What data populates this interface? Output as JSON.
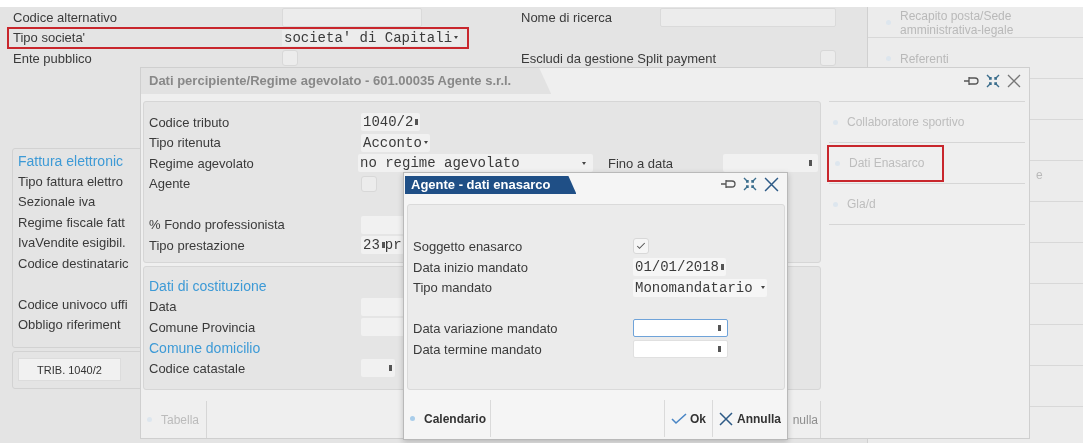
{
  "background_form": {
    "rows": [
      {
        "label": "Codice alternativo",
        "kind": "field",
        "highlighted": false
      },
      {
        "label": "Tipo societa'",
        "kind": "dropdown",
        "value": "societa' di Capitali",
        "highlighted": true
      },
      {
        "label": "Ente pubblico",
        "kind": "checkbox",
        "checked": false,
        "highlighted": false
      }
    ],
    "right_rows": [
      {
        "label": "Nome di ricerca",
        "kind": "field"
      },
      {
        "label": "Escludi da gestione Split payment",
        "kind": "checkbox",
        "checked": false,
        "gap_before": true
      }
    ],
    "fattura_section": {
      "title": "Fattura elettronic",
      "rows": [
        {
          "label": "Tipo fattura elettro"
        },
        {
          "label": "Sezionale iva"
        },
        {
          "label": "Regime fiscale fatt"
        },
        {
          "label": "IvaVendite esigibil."
        },
        {
          "label": "Codice destinataric"
        },
        {
          "label": "Codice univoco uffi",
          "gap_before": true
        },
        {
          "label": "Obbligo riferiment"
        }
      ]
    },
    "trib_button": "TRIB. 1040/2"
  },
  "sidebar": {
    "items": [
      {
        "label": "Recapito posta/Sede amministrativa-legale",
        "kind": "full"
      },
      {
        "label": "Referenti",
        "kind": "full"
      },
      {
        "label": "e",
        "kind": "cut"
      }
    ]
  },
  "dialog_percipiente": {
    "title": "Dati percipiente/Regime agevolato - 601.00035 Agente s.r.l.",
    "rows": [
      {
        "label": "Codice tributo",
        "kind": "code",
        "value": "1040/2"
      },
      {
        "label": "Tipo ritenuta",
        "kind": "dropdown",
        "value": "Acconto"
      },
      {
        "label": "Regime agevolato",
        "kind": "wide_dropdown",
        "value": "no regime agevolato",
        "extra_label": "Fino a data"
      },
      {
        "label": "Agente",
        "kind": "checkbox",
        "checked": false
      },
      {
        "label": "% Fondo professionista",
        "kind": "field",
        "gap_before": true
      },
      {
        "label": "Tipo prestazione",
        "kind": "code",
        "value": "23",
        "suffix": "pr"
      }
    ],
    "rows_lower": [
      {
        "label": "Dati di costituzione",
        "kind": "heading"
      },
      {
        "label": "Data",
        "kind": "field"
      },
      {
        "label": "Comune Provincia",
        "kind": "field"
      },
      {
        "label": "Comune domicilio",
        "kind": "heading"
      },
      {
        "label": "Codice catastale",
        "kind": "lookup"
      }
    ],
    "side_items": [
      {
        "label": "Collaboratore sportivo",
        "highlighted": false
      },
      {
        "label": "Dati Enasarco",
        "highlighted": true
      },
      {
        "label": "Gla/d",
        "highlighted": false
      }
    ],
    "footer": {
      "tabella": "Tabella",
      "annulla": "nulla"
    }
  },
  "dialog_enasarco": {
    "title": "Agente - dati enasarco",
    "rows": [
      {
        "label": "Soggetto enasarco",
        "kind": "checkbox",
        "checked": true
      },
      {
        "label": "Data inizio mandato",
        "kind": "date",
        "value": "01/01/2018"
      },
      {
        "label": "Tipo mandato",
        "kind": "dropdown",
        "value": "Monomandatario"
      },
      {
        "label": "Data variazione mandato",
        "kind": "date",
        "focused": true
      },
      {
        "label": "Data termine mandato",
        "kind": "date",
        "focused": false
      }
    ],
    "buttons": [
      {
        "label": "Calendario",
        "kind": "calendar"
      },
      {
        "label": "Ok",
        "kind": "ok"
      },
      {
        "label": "Annulla",
        "kind": "cancel"
      }
    ]
  }
}
